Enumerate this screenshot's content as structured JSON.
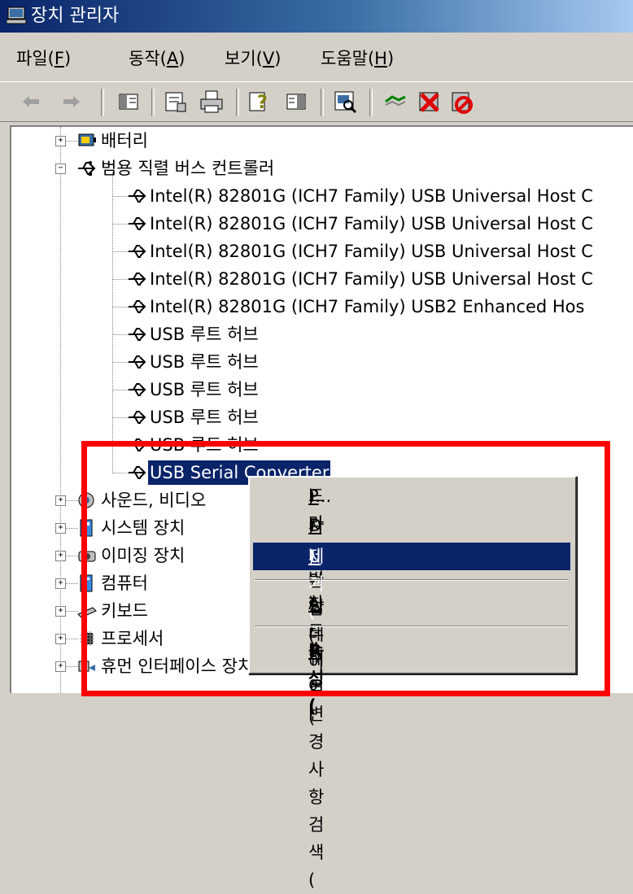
{
  "window": {
    "title": "장치 관리자"
  },
  "menu": [
    {
      "label": "파일(",
      "hotkey": "F",
      "close": ")"
    },
    {
      "label": "동작(",
      "hotkey": "A",
      "close": ")"
    },
    {
      "label": "보기(",
      "hotkey": "V",
      "close": ")"
    },
    {
      "label": "도움말(",
      "hotkey": "H",
      "close": ")"
    }
  ],
  "toolbar": {
    "icons": [
      "back-arrow-icon",
      "forward-arrow-icon",
      "show-hide-tree-icon",
      "properties-icon",
      "print-icon",
      "help-icon",
      "console-tree-icon",
      "scan-hardware-icon",
      "update-driver-icon",
      "uninstall-icon",
      "disable-icon"
    ]
  },
  "tree": {
    "battery": "배터리",
    "usb_controllers": "범용 직렬 버스 컨트롤러",
    "usb_children": [
      "Intel(R) 82801G (ICH7 Family) USB Universal Host C",
      "Intel(R) 82801G (ICH7 Family) USB Universal Host C",
      "Intel(R) 82801G (ICH7 Family) USB Universal Host C",
      "Intel(R) 82801G (ICH7 Family) USB Universal Host C",
      "Intel(R) 82801G (ICH7 Family) USB2 Enhanced Hos",
      "USB 루트 허브",
      "USB 루트 허브",
      "USB 루트 허브",
      "USB 루트 허브",
      "USB 루트 허브",
      "USB Serial Converter"
    ],
    "other_categories": [
      "사운드, 비디오",
      "시스템 장치",
      "이미징 장치",
      "컴퓨터",
      "키보드",
      "프로세서",
      "휴먼 인터페이스 장치"
    ]
  },
  "context_menu": {
    "update_driver": {
      "pre": "드라이버 업데이트(",
      "hotkey": "P",
      "post": ")..."
    },
    "disable": {
      "pre": "사용 안 함(",
      "hotkey": "D",
      "post": ")"
    },
    "uninstall": {
      "pre": "제거(",
      "hotkey": "U",
      "post": ")"
    },
    "scan": {
      "pre": "하드웨어 변경 사항 검색(",
      "hotkey": "A",
      "post": ")"
    },
    "properties": {
      "pre": "속성(",
      "hotkey": "R",
      "post": ")"
    }
  },
  "colors": {
    "selection": "#0a246a",
    "highlight_box": "#ff0000",
    "window_bg": "#d4d0c8"
  }
}
